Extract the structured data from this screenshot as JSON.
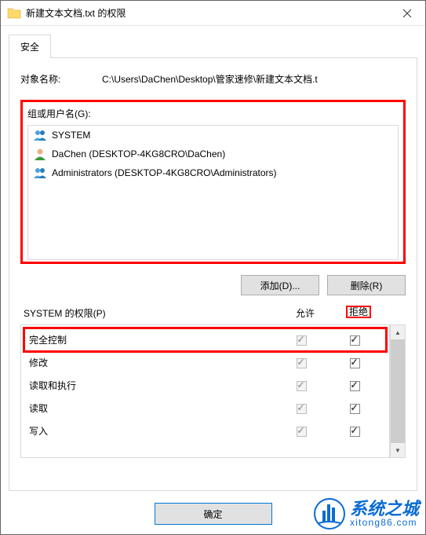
{
  "titlebar": {
    "title": "新建文本文档.txt 的权限"
  },
  "tabs": {
    "security": "安全"
  },
  "object": {
    "label": "对象名称:",
    "path": "C:\\Users\\DaChen\\Desktop\\管家速修\\新建文本文档.t"
  },
  "groups": {
    "label": "组或用户名(G):",
    "items": [
      {
        "name": "SYSTEM",
        "icon": "group"
      },
      {
        "name": "DaChen (DESKTOP-4KG8CRO\\DaChen)",
        "icon": "user"
      },
      {
        "name": "Administrators (DESKTOP-4KG8CRO\\Administrators)",
        "icon": "group"
      }
    ]
  },
  "buttons": {
    "add": "添加(D)...",
    "remove": "删除(R)",
    "ok": "确定"
  },
  "permissions": {
    "header_label": "SYSTEM 的权限(P)",
    "allow": "允许",
    "deny": "拒绝",
    "rows": [
      {
        "name": "完全控制",
        "allow": true,
        "deny": true,
        "highlight": true
      },
      {
        "name": "修改",
        "allow": true,
        "deny": true
      },
      {
        "name": "读取和执行",
        "allow": true,
        "deny": true
      },
      {
        "name": "读取",
        "allow": true,
        "deny": true
      },
      {
        "name": "写入",
        "allow": true,
        "deny": true
      }
    ]
  },
  "watermark": {
    "big": "系统之城",
    "small": "xitong86.com"
  }
}
